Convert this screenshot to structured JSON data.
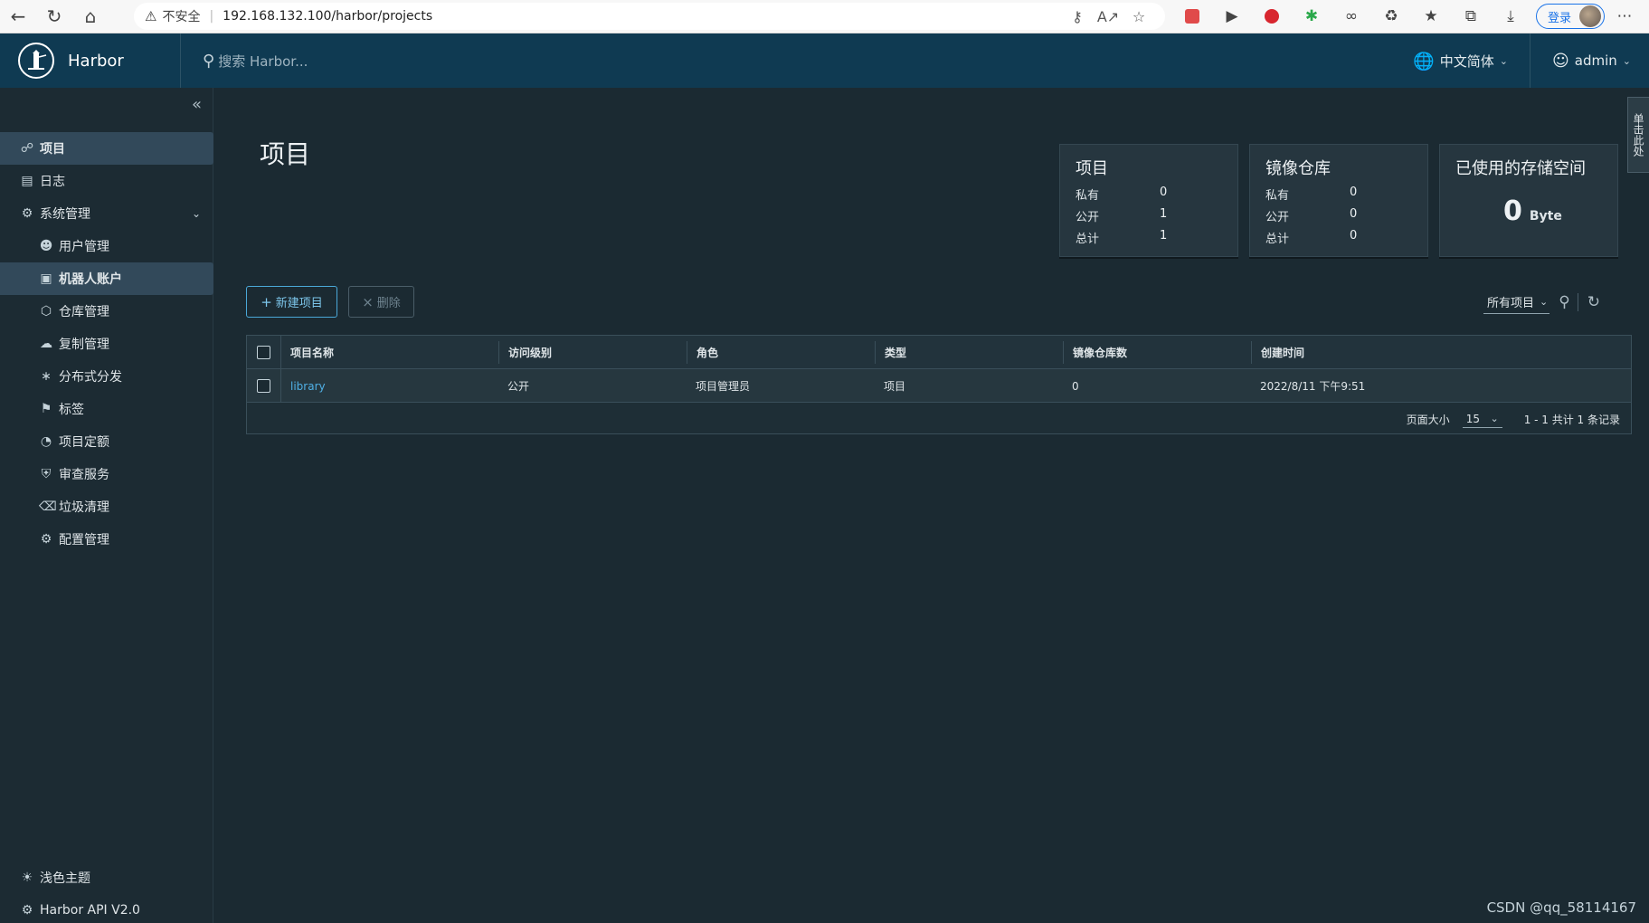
{
  "browser": {
    "back_icon": "arrow-left-icon",
    "refresh_icon": "refresh-icon",
    "home_icon": "home-icon",
    "security_label": "不安全",
    "url": "192.168.132.100/harbor/projects",
    "login_label": "登录"
  },
  "header": {
    "brand": "Harbor",
    "search_placeholder": "搜索 Harbor...",
    "language": "中文简体",
    "user": "admin"
  },
  "sidebar": {
    "projects": "项目",
    "logs": "日志",
    "admin": "系统管理",
    "sub_items": [
      "用户管理",
      "机器人账户",
      "仓库管理",
      "复制管理",
      "分布式分发",
      "标签",
      "项目定额",
      "审查服务",
      "垃圾清理",
      "配置管理"
    ],
    "theme": "浅色主题",
    "api": "Harbor API V2.0"
  },
  "main": {
    "title": "项目",
    "cards": {
      "projects": {
        "title": "项目",
        "rows": [
          {
            "label": "私有",
            "value": "0"
          },
          {
            "label": "公开",
            "value": "1"
          },
          {
            "label": "总计",
            "value": "1"
          }
        ]
      },
      "repos": {
        "title": "镜像仓库",
        "rows": [
          {
            "label": "私有",
            "value": "0"
          },
          {
            "label": "公开",
            "value": "0"
          },
          {
            "label": "总计",
            "value": "0"
          }
        ]
      },
      "storage": {
        "title": "已使用的存储空间",
        "value": "0",
        "unit": "Byte"
      }
    },
    "new_project": "新建项目",
    "delete": "删除",
    "filter": "所有项目",
    "table": {
      "headers": [
        "项目名称",
        "访问级别",
        "角色",
        "类型",
        "镜像仓库数",
        "创建时间"
      ],
      "rows": [
        [
          "library",
          "公开",
          "项目管理员",
          "项目",
          "0",
          "2022/8/11 下午9:51"
        ]
      ],
      "page_size_label": "页面大小",
      "page_size": "15",
      "summary": "1 - 1 共计 1 条记录"
    },
    "feedback": "单击此处"
  },
  "watermark": "CSDN @qq_58114167"
}
